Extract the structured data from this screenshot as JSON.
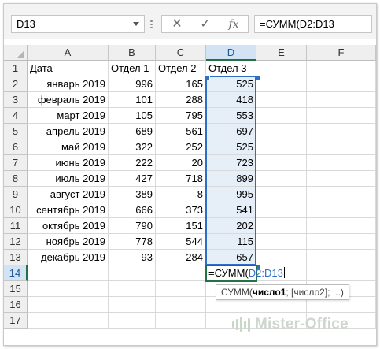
{
  "name_box": "D13",
  "formula_bar": {
    "cancel_icon": "✕",
    "enter_icon": "✓",
    "fx_label": "fx",
    "formula_text": "=СУММ(D2:D13"
  },
  "columns": [
    "A",
    "B",
    "C",
    "D",
    "E",
    "F"
  ],
  "rows": [
    "1",
    "2",
    "3",
    "4",
    "5",
    "6",
    "7",
    "8",
    "9",
    "10",
    "11",
    "12",
    "13",
    "14",
    "15",
    "16",
    "17"
  ],
  "headers": {
    "a": "Дата",
    "b": "Отдел 1",
    "c": "Отдел 2",
    "d": "Отдел 3"
  },
  "data_rows": [
    {
      "a": "январь 2019",
      "b": "996",
      "c": "165",
      "d": "525"
    },
    {
      "a": "февраль 2019",
      "b": "101",
      "c": "288",
      "d": "418"
    },
    {
      "a": "март 2019",
      "b": "105",
      "c": "795",
      "d": "553"
    },
    {
      "a": "апрель 2019",
      "b": "689",
      "c": "561",
      "d": "697"
    },
    {
      "a": "май 2019",
      "b": "322",
      "c": "252",
      "d": "525"
    },
    {
      "a": "июнь 2019",
      "b": "222",
      "c": "20",
      "d": "723"
    },
    {
      "a": "июль 2019",
      "b": "427",
      "c": "718",
      "d": "899"
    },
    {
      "a": "август 2019",
      "b": "389",
      "c": "8",
      "d": "995"
    },
    {
      "a": "сентябрь 2019",
      "b": "666",
      "c": "373",
      "d": "541"
    },
    {
      "a": "октябрь 2019",
      "b": "790",
      "c": "151",
      "d": "202"
    },
    {
      "a": "ноябрь 2019",
      "b": "778",
      "c": "544",
      "d": "115"
    },
    {
      "a": "декабрь 2019",
      "b": "93",
      "c": "284",
      "d": "657"
    }
  ],
  "edit_cell": {
    "prefix": "=СУММ(",
    "ref": "D2:D13"
  },
  "tooltip": {
    "func": "СУММ(",
    "arg1": "число1",
    "rest": "; [число2]; ...)"
  },
  "watermark": "Mister-Office",
  "colors": {
    "selection": "#2e6ec7",
    "active": "#217346",
    "range_fill": "#e6eef8"
  }
}
